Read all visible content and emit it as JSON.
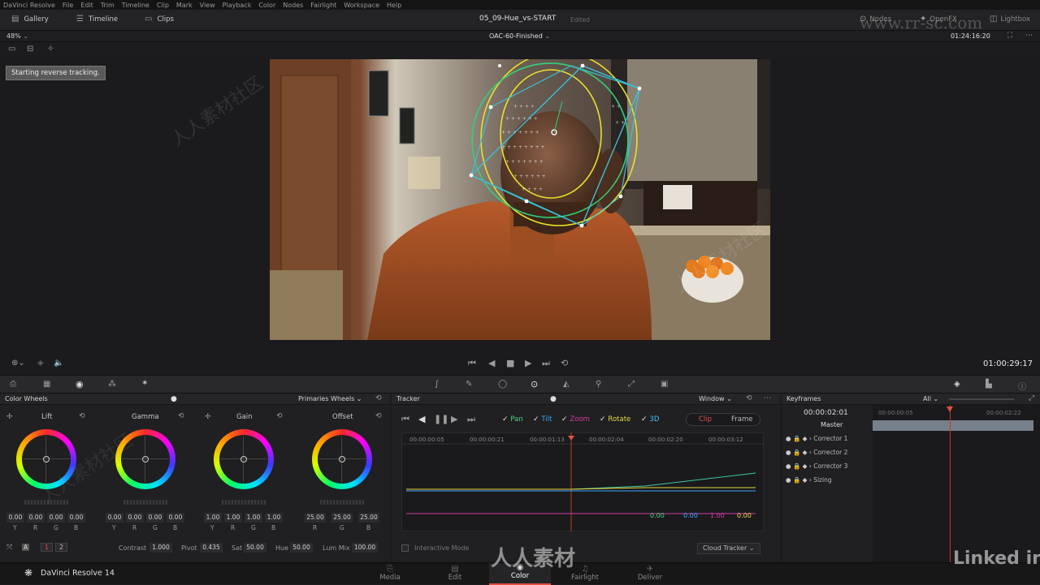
{
  "menu": [
    "DaVinci Resolve",
    "File",
    "Edit",
    "Trim",
    "Timeline",
    "Clip",
    "Mark",
    "View",
    "Playback",
    "Color",
    "Nodes",
    "Fairlight",
    "Workspace",
    "Help"
  ],
  "toolbar": {
    "gallery": "Gallery",
    "timeline": "Timeline",
    "clips": "Clips",
    "project": "05_09-Hue_vs-START",
    "edited": "Edited",
    "nodes": "Nodes",
    "openfx": "OpenFX",
    "lightbox": "Lightbox"
  },
  "viewerbar": {
    "zoom": "48%",
    "clip_name": "OAC-60-Finished",
    "timecode": "01:24:16:20"
  },
  "status_tooltip": "Starting reverse tracking.",
  "transport": {
    "timecode": "01:00:29:17"
  },
  "color_wheels": {
    "title": "Color Wheels",
    "mode": "Primaries Wheels",
    "wheels": [
      {
        "name": "Lift",
        "values": [
          "0.00",
          "0.00",
          "0.00",
          "0.00"
        ]
      },
      {
        "name": "Gamma",
        "values": [
          "0.00",
          "0.00",
          "0.00",
          "0.00"
        ]
      },
      {
        "name": "Gain",
        "values": [
          "1.00",
          "1.00",
          "1.00",
          "1.00"
        ]
      },
      {
        "name": "Offset",
        "values": [
          "25.00",
          "25.00",
          "25.00"
        ]
      }
    ],
    "channels4": [
      "Y",
      "R",
      "G",
      "B"
    ],
    "channels3": [
      "R",
      "G",
      "B"
    ],
    "pages": [
      "1",
      "2"
    ],
    "contrast_label": "Contrast",
    "contrast": "1.000",
    "pivot_label": "Pivot",
    "pivot": "0.435",
    "sat_label": "Sat",
    "sat": "50.00",
    "hue_label": "Hue",
    "hue": "50.00",
    "lummix_label": "Lum Mix",
    "lummix": "100.00"
  },
  "tracker": {
    "title": "Tracker",
    "mode": "Window",
    "options": [
      "Pan",
      "Tilt",
      "Zoom",
      "Rotate",
      "3D"
    ],
    "option_colors": [
      "#4fd07a",
      "#3aa6ff",
      "#d23aa8",
      "#e8d640",
      "#3ec7ff"
    ],
    "clip": "Clip",
    "frame": "Frame",
    "ruler": [
      "00:00:00:05",
      "00:00:00:21",
      "00:00:01:13",
      "00:00:02:04",
      "00:00:02:20",
      "00:00:03:12"
    ],
    "values": [
      "0.00",
      "0.00",
      "1.00",
      "0.00"
    ],
    "interactive_mode": "Interactive Mode",
    "cloud_tracker": "Cloud Tracker"
  },
  "keyframes": {
    "title": "Keyframes",
    "filter": "All",
    "timecode": "00:00:02:01",
    "ruler_a": "00:00:00:05",
    "ruler_b": "00:00:02:22",
    "master": "Master",
    "rows": [
      "Corrector 1",
      "Corrector 2",
      "Corrector 3",
      "Sizing"
    ]
  },
  "bottom_nav": {
    "app": "DaVinci Resolve 14",
    "pages": [
      "Media",
      "Edit",
      "Color",
      "Fairlight",
      "Deliver"
    ],
    "active": "Color"
  },
  "watermark": {
    "text": "人人素材社区",
    "url": "www.rr-sc.com",
    "brand": "Linked in",
    "site": "人人素材"
  }
}
